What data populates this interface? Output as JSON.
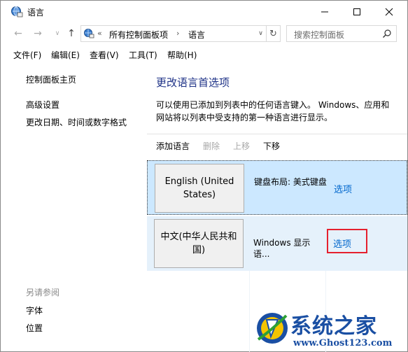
{
  "window": {
    "title": "语言"
  },
  "nav": {
    "breadcrumb_prefix": "«",
    "crumb1": "所有控制面板项",
    "separator": "›",
    "crumb2": "语言",
    "search_placeholder": "搜索控制面板"
  },
  "menu": [
    {
      "label": "文件(F)"
    },
    {
      "label": "编辑(E)"
    },
    {
      "label": "查看(V)"
    },
    {
      "label": "工具(T)"
    },
    {
      "label": "帮助(H)"
    }
  ],
  "left": {
    "home": "控制面板主页",
    "advanced": "高级设置",
    "change_date": "更改日期、时间或数字格式",
    "see_also": "另请参阅",
    "fonts": "字体",
    "location": "位置"
  },
  "main": {
    "title": "更改语言首选项",
    "desc": "可以使用已添加到列表中的任何语言键入。 Windows、应用和网站将以列表中受支持的第一种语言进行显示。"
  },
  "toolbar": {
    "add": "添加语言",
    "remove": "删除",
    "up": "上移",
    "down": "下移"
  },
  "languages": [
    {
      "name": "English (United States)",
      "info": "键盘布局: 美式键盘",
      "options": "选项"
    },
    {
      "name": "中文(中华人民共和国)",
      "info": "Windows 显示语...",
      "options": "选项"
    }
  ],
  "watermark": {
    "title": "系统之家",
    "url": "www.Ghost123.com"
  },
  "colors": {
    "link": "#0066cc",
    "title": "#1e3287",
    "selected_row": "#cce8ff",
    "row": "#e5f1fb",
    "highlight": "#e5202e"
  }
}
